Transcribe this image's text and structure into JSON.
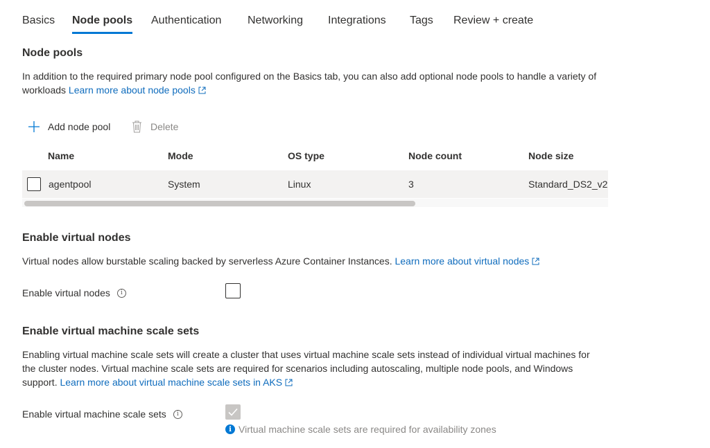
{
  "tabs": [
    {
      "label": "Basics",
      "active": false
    },
    {
      "label": "Node pools",
      "active": true
    },
    {
      "label": "Authentication",
      "active": false
    },
    {
      "label": "Networking",
      "active": false
    },
    {
      "label": "Integrations",
      "active": false
    },
    {
      "label": "Tags",
      "active": false
    },
    {
      "label": "Review + create",
      "active": false
    }
  ],
  "node_pools": {
    "title": "Node pools",
    "description": "In addition to the required primary node pool configured on the Basics tab, you can also add optional node pools to handle a variety of workloads",
    "learn_more": "Learn more about node pools",
    "toolbar": {
      "add_label": "Add node pool",
      "delete_label": "Delete"
    },
    "columns": [
      "Name",
      "Mode",
      "OS type",
      "Node count",
      "Node size"
    ],
    "rows": [
      {
        "name": "agentpool",
        "mode": "System",
        "os_type": "Linux",
        "node_count": "3",
        "node_size": "Standard_DS2_v2"
      }
    ]
  },
  "virtual_nodes": {
    "title": "Enable virtual nodes",
    "description": "Virtual nodes allow burstable scaling backed by serverless Azure Container Instances.",
    "learn_more": "Learn more about virtual nodes",
    "field_label": "Enable virtual nodes",
    "checked": false
  },
  "vmss": {
    "title": "Enable virtual machine scale sets",
    "description": "Enabling virtual machine scale sets will create a cluster that uses virtual machine scale sets instead of individual virtual machines for the cluster nodes. Virtual machine scale sets are required for scenarios including autoscaling, multiple node pools, and Windows support.",
    "learn_more": "Learn more about virtual machine scale sets in AKS",
    "field_label": "Enable virtual machine scale sets",
    "checked": true,
    "disabled": true,
    "info_message": "Virtual machine scale sets are required for availability zones"
  },
  "colors": {
    "accent": "#0078d4",
    "link": "#0f6cbd",
    "row_bg": "#f3f2f1",
    "disabled": "#c8c6c4"
  }
}
